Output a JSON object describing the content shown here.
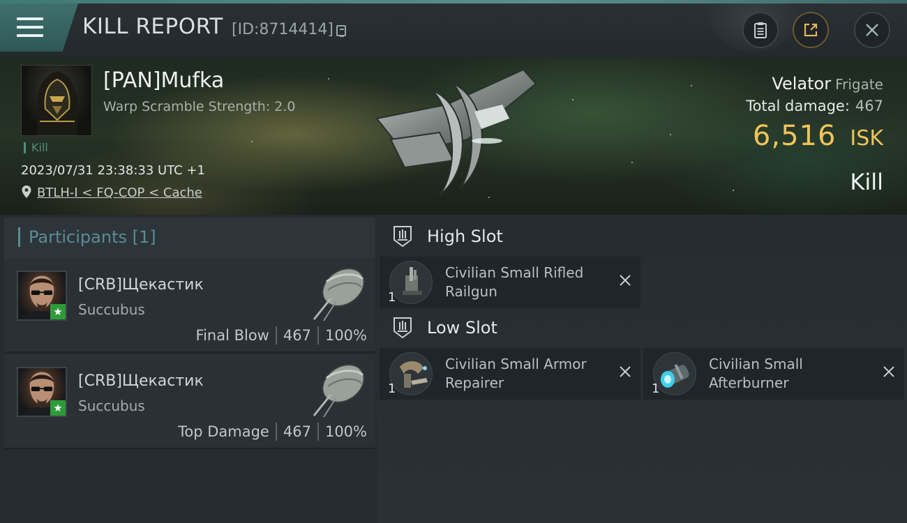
{
  "header": {
    "title": "KILL REPORT",
    "report_id": "[ID:8714414]"
  },
  "victim": {
    "name": "[PAN]Mufka",
    "warp_scramble": "Warp Scramble Strength: 2.0",
    "tag": "Kill",
    "datetime": "2023/07/31 23:38:33 UTC +1",
    "location": "BTLH-I < FQ-COP < Cache",
    "ship_name": "Velator",
    "ship_class": "Frigate",
    "total_damage_label": "Total damage:",
    "total_damage": "467",
    "isk_value": "6,516",
    "isk_unit": "ISK",
    "result": "Kill"
  },
  "participants": {
    "header": "Participants [1]",
    "rows": [
      {
        "name": "[CRB]Щекастик",
        "ship": "Succubus",
        "role": "Final Blow",
        "damage": "467",
        "percent": "100%"
      },
      {
        "name": "[CRB]Щекастик",
        "ship": "Succubus",
        "role": "Top Damage",
        "damage": "467",
        "percent": "100%"
      }
    ]
  },
  "fitting": {
    "high_slot_label": "High Slot",
    "low_slot_label": "Low Slot",
    "high_slot": [
      {
        "name": "Civilian Small Rifled Railgun",
        "qty": "1"
      }
    ],
    "low_slot": [
      {
        "name": "Civilian Small Armor Repairer",
        "qty": "1"
      },
      {
        "name": "Civilian Small Afterburner",
        "qty": "1"
      }
    ]
  },
  "colors": {
    "accent_teal": "#4f8f85",
    "isk_gold": "#f0c45a",
    "badge_green": "#2e9b3a"
  }
}
